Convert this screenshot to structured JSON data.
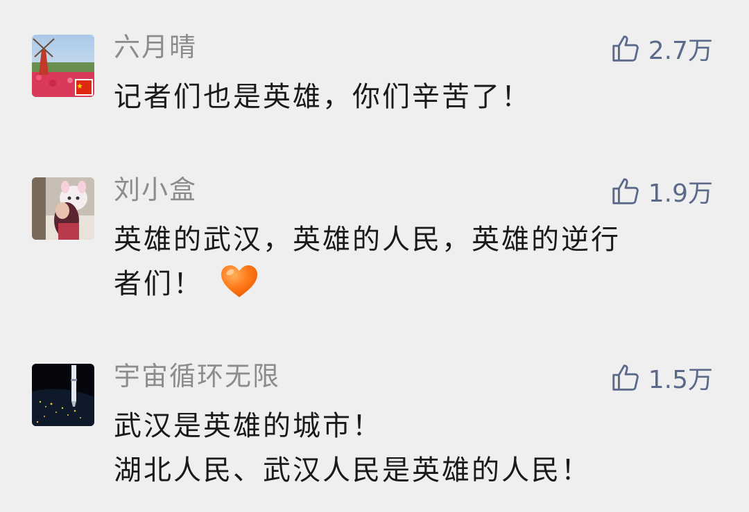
{
  "comments": [
    {
      "username": "六月晴",
      "likes": "2.7万",
      "avatar_icon": "avatar-windmill-flowers-photo",
      "lines": [
        "记者们也是英雄，你们辛苦了！"
      ]
    },
    {
      "username": "刘小盒",
      "likes": "1.9万",
      "avatar_icon": "avatar-girl-with-plush-photo",
      "lines": [
        "英雄的武汉，英雄的人民，英雄的逆行",
        "者们！"
      ],
      "emoji": "orange-heart-icon"
    },
    {
      "username": "宇宙循环无限",
      "likes": "1.5万",
      "avatar_icon": "avatar-earth-night-rocket-photo",
      "lines": [
        "武汉是英雄的城市！",
        "湖北人民、武汉人民是英雄的人民！"
      ]
    }
  ],
  "colors": {
    "background": "#efefef",
    "username": "#8c8c8c",
    "like": "#5b6a8a",
    "text": "#1a1a1a",
    "heart": "#ff7a1a"
  }
}
